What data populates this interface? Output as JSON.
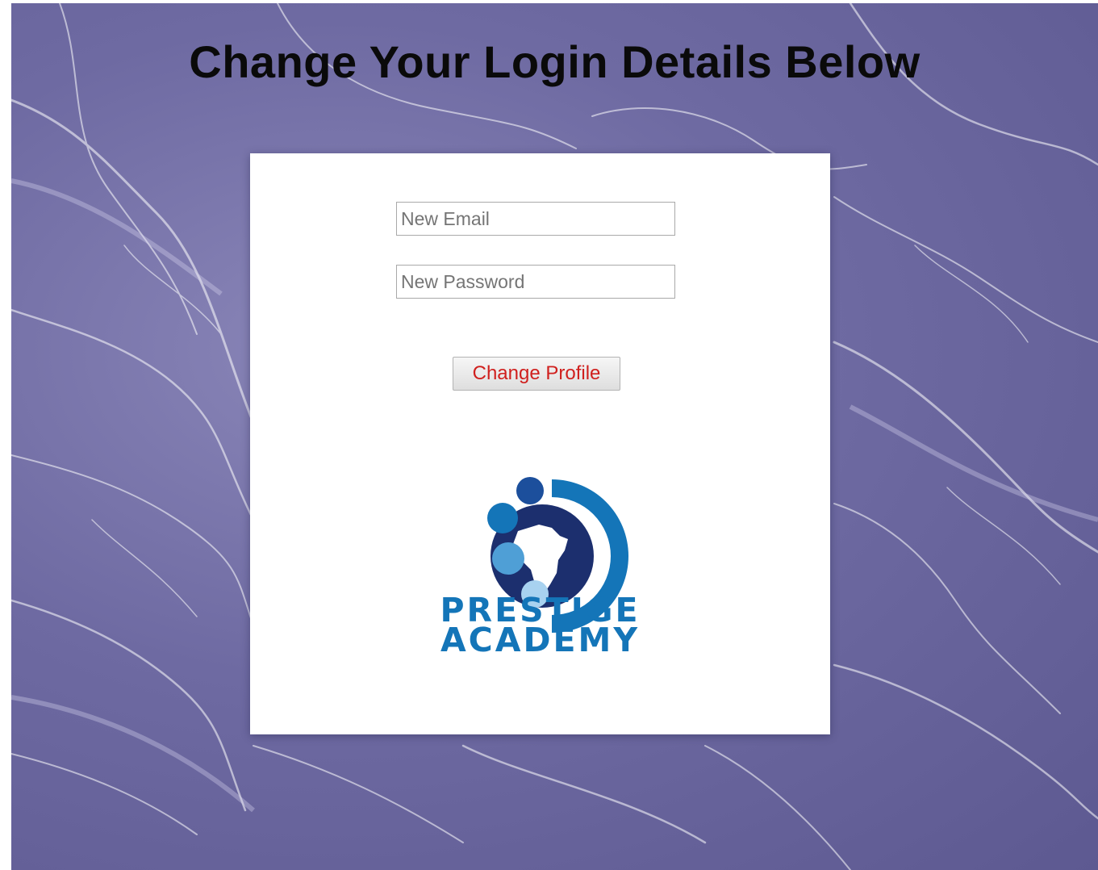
{
  "page": {
    "title": "Change Your Login Details Below"
  },
  "form": {
    "email_placeholder": "New Email",
    "email_value": "",
    "password_placeholder": "New Password",
    "password_value": "",
    "submit_label": "Change Profile"
  },
  "brand": {
    "name_line1": "PRESTIGE",
    "name_line2": "ACADEMY",
    "logo_icon": "globe-africa-icon"
  },
  "colors": {
    "background": "#6e6aa2",
    "brand_blue": "#1475b8",
    "brand_navy": "#1c2f6e",
    "button_text": "#d0201e"
  }
}
